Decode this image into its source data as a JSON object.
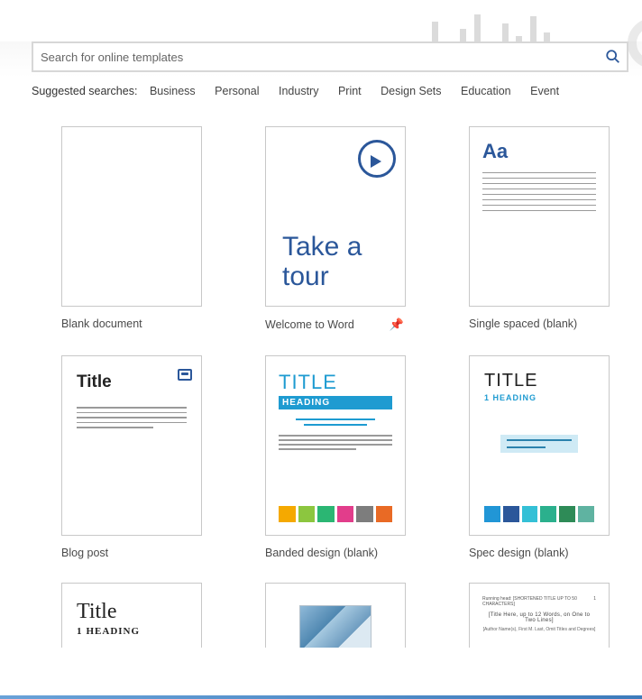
{
  "search": {
    "placeholder": "Search for online templates"
  },
  "suggested": {
    "label": "Suggested searches:",
    "links": [
      "Business",
      "Personal",
      "Industry",
      "Print",
      "Design Sets",
      "Education",
      "Event"
    ]
  },
  "templates": [
    {
      "label": "Blank document",
      "pinned": false
    },
    {
      "label": "Welcome to Word",
      "pinned": true,
      "tour_text": "Take a tour"
    },
    {
      "label": "Single spaced (blank)",
      "pinned": false,
      "aa": "Aa"
    },
    {
      "label": "Blog post",
      "pinned": false,
      "title": "Title"
    },
    {
      "label": "Banded design (blank)",
      "pinned": false,
      "title": "TITLE",
      "heading": "HEADING",
      "swatches": [
        "#f5a900",
        "#8cc63f",
        "#2bb673",
        "#e23d8b",
        "#7d7d7d",
        "#e96a25"
      ]
    },
    {
      "label": "Spec design (blank)",
      "pinned": false,
      "title": "TITLE",
      "heading": "1 HEADING",
      "swatches": [
        "#2196d6",
        "#2b579a",
        "#34c0d6",
        "#2bb08d",
        "#2e8b57",
        "#5fb3a1"
      ]
    },
    {
      "label": "",
      "row3": true,
      "kind": "report",
      "title": "Title",
      "heading": "HEADING",
      "num": "1"
    },
    {
      "label": "",
      "row3": true,
      "kind": "photo"
    },
    {
      "label": "",
      "row3": true,
      "kind": "paper",
      "topline_left": "Running head: [SHORTENED TITLE UP TO 50 CHARACTERS]",
      "topline_right": "1",
      "ptitle": "[Title Here, up to 12 Words, on One to Two Lines]",
      "psub": "[Author Name(s), First M. Last, Omit Titles and Degrees]"
    }
  ]
}
